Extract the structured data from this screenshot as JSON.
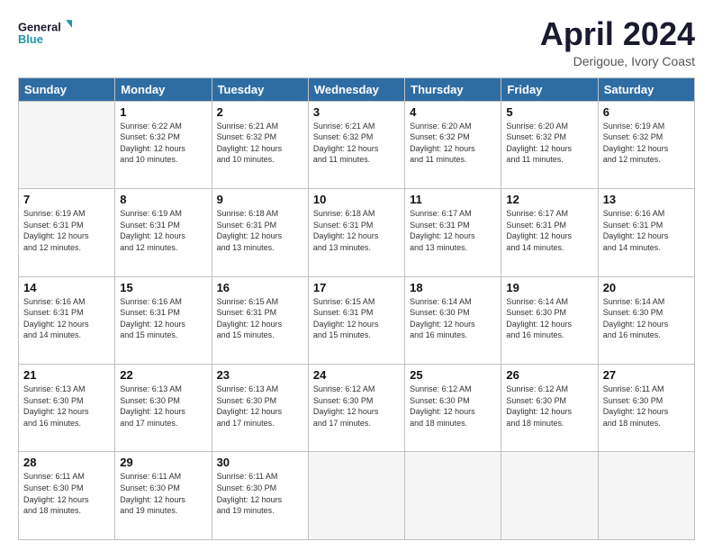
{
  "header": {
    "logo_line1": "General",
    "logo_line2": "Blue",
    "title": "April 2024",
    "subtitle": "Derigoue, Ivory Coast"
  },
  "columns": [
    "Sunday",
    "Monday",
    "Tuesday",
    "Wednesday",
    "Thursday",
    "Friday",
    "Saturday"
  ],
  "weeks": [
    [
      {
        "day": "",
        "info": ""
      },
      {
        "day": "1",
        "info": "Sunrise: 6:22 AM\nSunset: 6:32 PM\nDaylight: 12 hours\nand 10 minutes."
      },
      {
        "day": "2",
        "info": "Sunrise: 6:21 AM\nSunset: 6:32 PM\nDaylight: 12 hours\nand 10 minutes."
      },
      {
        "day": "3",
        "info": "Sunrise: 6:21 AM\nSunset: 6:32 PM\nDaylight: 12 hours\nand 11 minutes."
      },
      {
        "day": "4",
        "info": "Sunrise: 6:20 AM\nSunset: 6:32 PM\nDaylight: 12 hours\nand 11 minutes."
      },
      {
        "day": "5",
        "info": "Sunrise: 6:20 AM\nSunset: 6:32 PM\nDaylight: 12 hours\nand 11 minutes."
      },
      {
        "day": "6",
        "info": "Sunrise: 6:19 AM\nSunset: 6:32 PM\nDaylight: 12 hours\nand 12 minutes."
      }
    ],
    [
      {
        "day": "7",
        "info": "Sunrise: 6:19 AM\nSunset: 6:31 PM\nDaylight: 12 hours\nand 12 minutes."
      },
      {
        "day": "8",
        "info": "Sunrise: 6:19 AM\nSunset: 6:31 PM\nDaylight: 12 hours\nand 12 minutes."
      },
      {
        "day": "9",
        "info": "Sunrise: 6:18 AM\nSunset: 6:31 PM\nDaylight: 12 hours\nand 13 minutes."
      },
      {
        "day": "10",
        "info": "Sunrise: 6:18 AM\nSunset: 6:31 PM\nDaylight: 12 hours\nand 13 minutes."
      },
      {
        "day": "11",
        "info": "Sunrise: 6:17 AM\nSunset: 6:31 PM\nDaylight: 12 hours\nand 13 minutes."
      },
      {
        "day": "12",
        "info": "Sunrise: 6:17 AM\nSunset: 6:31 PM\nDaylight: 12 hours\nand 14 minutes."
      },
      {
        "day": "13",
        "info": "Sunrise: 6:16 AM\nSunset: 6:31 PM\nDaylight: 12 hours\nand 14 minutes."
      }
    ],
    [
      {
        "day": "14",
        "info": "Sunrise: 6:16 AM\nSunset: 6:31 PM\nDaylight: 12 hours\nand 14 minutes."
      },
      {
        "day": "15",
        "info": "Sunrise: 6:16 AM\nSunset: 6:31 PM\nDaylight: 12 hours\nand 15 minutes."
      },
      {
        "day": "16",
        "info": "Sunrise: 6:15 AM\nSunset: 6:31 PM\nDaylight: 12 hours\nand 15 minutes."
      },
      {
        "day": "17",
        "info": "Sunrise: 6:15 AM\nSunset: 6:31 PM\nDaylight: 12 hours\nand 15 minutes."
      },
      {
        "day": "18",
        "info": "Sunrise: 6:14 AM\nSunset: 6:30 PM\nDaylight: 12 hours\nand 16 minutes."
      },
      {
        "day": "19",
        "info": "Sunrise: 6:14 AM\nSunset: 6:30 PM\nDaylight: 12 hours\nand 16 minutes."
      },
      {
        "day": "20",
        "info": "Sunrise: 6:14 AM\nSunset: 6:30 PM\nDaylight: 12 hours\nand 16 minutes."
      }
    ],
    [
      {
        "day": "21",
        "info": "Sunrise: 6:13 AM\nSunset: 6:30 PM\nDaylight: 12 hours\nand 16 minutes."
      },
      {
        "day": "22",
        "info": "Sunrise: 6:13 AM\nSunset: 6:30 PM\nDaylight: 12 hours\nand 17 minutes."
      },
      {
        "day": "23",
        "info": "Sunrise: 6:13 AM\nSunset: 6:30 PM\nDaylight: 12 hours\nand 17 minutes."
      },
      {
        "day": "24",
        "info": "Sunrise: 6:12 AM\nSunset: 6:30 PM\nDaylight: 12 hours\nand 17 minutes."
      },
      {
        "day": "25",
        "info": "Sunrise: 6:12 AM\nSunset: 6:30 PM\nDaylight: 12 hours\nand 18 minutes."
      },
      {
        "day": "26",
        "info": "Sunrise: 6:12 AM\nSunset: 6:30 PM\nDaylight: 12 hours\nand 18 minutes."
      },
      {
        "day": "27",
        "info": "Sunrise: 6:11 AM\nSunset: 6:30 PM\nDaylight: 12 hours\nand 18 minutes."
      }
    ],
    [
      {
        "day": "28",
        "info": "Sunrise: 6:11 AM\nSunset: 6:30 PM\nDaylight: 12 hours\nand 18 minutes."
      },
      {
        "day": "29",
        "info": "Sunrise: 6:11 AM\nSunset: 6:30 PM\nDaylight: 12 hours\nand 19 minutes."
      },
      {
        "day": "30",
        "info": "Sunrise: 6:11 AM\nSunset: 6:30 PM\nDaylight: 12 hours\nand 19 minutes."
      },
      {
        "day": "",
        "info": ""
      },
      {
        "day": "",
        "info": ""
      },
      {
        "day": "",
        "info": ""
      },
      {
        "day": "",
        "info": ""
      }
    ]
  ]
}
